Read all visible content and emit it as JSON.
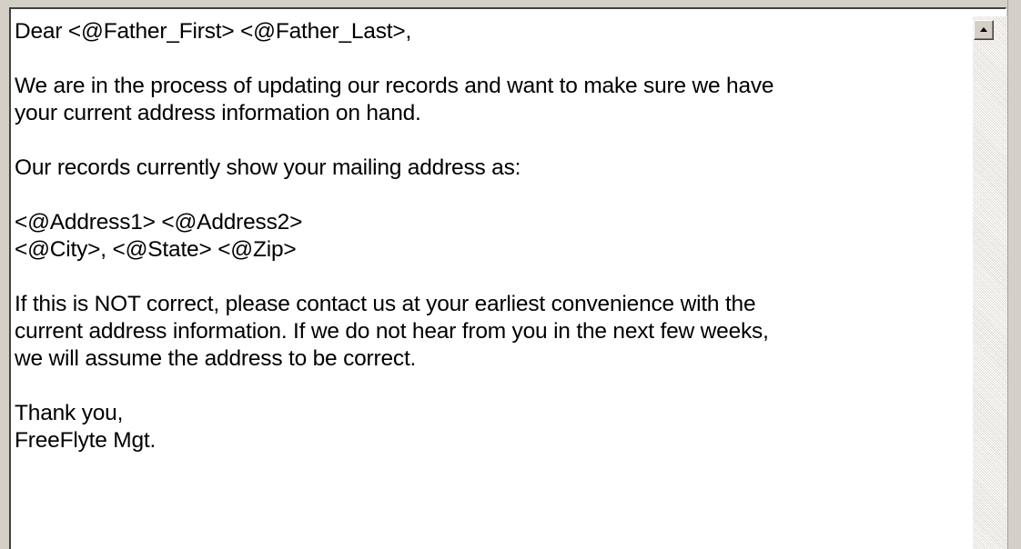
{
  "letter": {
    "lines": [
      "Dear <@Father_First> <@Father_Last>,",
      "",
      "We are in the process of updating our records and want to make sure we have",
      "your current address information on hand.",
      "",
      "Our records currently show your mailing address as:",
      "",
      "<@Address1> <@Address2>",
      "<@City>, <@State> <@Zip>",
      "",
      "If this is NOT correct, please contact us at your earliest convenience with the",
      "current address information. If we do not hear from you in the next few weeks,",
      "we will assume the address to be correct.",
      "",
      "Thank you,",
      "FreeFlyte Mgt."
    ]
  },
  "scrollbar": {
    "up_icon": "up-arrow-icon"
  }
}
